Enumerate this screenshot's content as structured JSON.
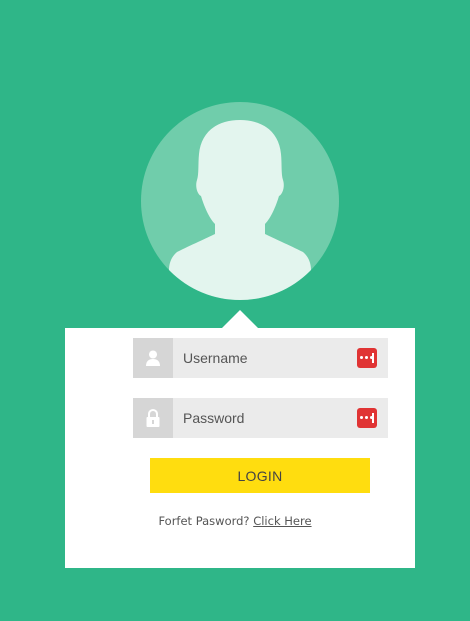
{
  "colors": {
    "background": "#2fb688",
    "avatar_circle": "#70cdab",
    "avatar_silhouette": "#e3f5ee",
    "card": "#ffffff",
    "field_bg": "#ebebeb",
    "icon_box": "#d6d6d6",
    "badge": "#e03434",
    "login_button": "#ffdd0f"
  },
  "avatar": {
    "icon": "user-silhouette"
  },
  "form": {
    "username": {
      "placeholder": "Username",
      "value": "",
      "icon": "user-icon",
      "badge_icon": "password-manager-icon"
    },
    "password": {
      "placeholder": "Password",
      "value": "",
      "icon": "lock-icon",
      "badge_icon": "password-manager-icon"
    },
    "login_label": "LOGIN",
    "forgot_text": "Forfet Pasword?",
    "forgot_link": "Click Here"
  }
}
